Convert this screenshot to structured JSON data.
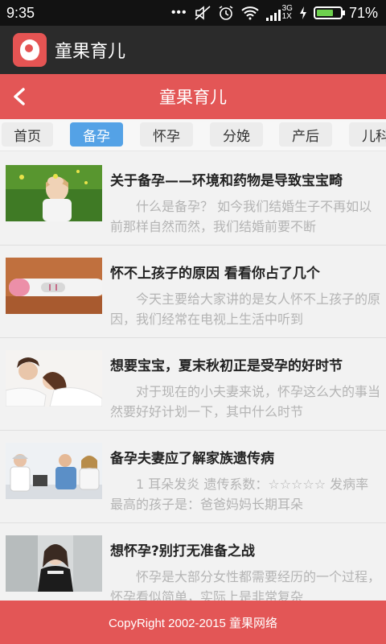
{
  "status_bar": {
    "time": "9:35",
    "network": "3G",
    "network_sub": "1X",
    "battery": "71%",
    "battery_level": 0.71,
    "icons": [
      "more-icon",
      "mute-icon",
      "alarm-icon",
      "wifi-icon",
      "signal-icon",
      "charging-icon",
      "battery-icon"
    ]
  },
  "app_header": {
    "title": "童果育儿",
    "logo_icon": "baby-logo-icon"
  },
  "title_bar": {
    "title": "童果育儿",
    "back_icon": "chevron-left-icon"
  },
  "tabs": [
    {
      "label": "首页",
      "active": false
    },
    {
      "label": "备孕",
      "active": true
    },
    {
      "label": "怀孕",
      "active": false
    },
    {
      "label": "分娩",
      "active": false
    },
    {
      "label": "产后",
      "active": false
    },
    {
      "label": "儿科",
      "active": false
    }
  ],
  "articles": [
    {
      "title": "关于备孕——环境和药物是导致宝宝畸",
      "desc": "什么是备孕？ 如今我们结婚生子不再如以前那样自然而然，我们结婚前要不断",
      "image": "child-on-grass-image"
    },
    {
      "title": "怀不上孩子的原因 看看你占了几个",
      "desc": "今天主要给大家讲的是女人怀不上孩子的原因，我们经常在电视上生活中听到",
      "image": "pregnancy-test-image"
    },
    {
      "title": "想要宝宝，夏末秋初正是受孕的好时节",
      "desc": "对于现在的小夫妻来说，怀孕这么大的事当然要好好计划一下，其中什么时节",
      "image": "couple-lying-image"
    },
    {
      "title": "备孕夫妻应了解家族遗传病",
      "desc": "1 耳朵发炎 遗传系数：☆☆☆☆☆ 发病率最高的孩子是：爸爸妈妈长期耳朵",
      "image": "doctor-consultation-image"
    },
    {
      "title": "想怀孕?别打无准备之战",
      "desc": "怀孕是大部分女性都需要经历的一个过程，怀孕看似简单，实际上是非常复杂",
      "image": "pregnant-woman-image"
    }
  ],
  "footer": {
    "text": "CopyRight 2002-2015 童果网络"
  },
  "colors": {
    "brand_red": "#e35656",
    "active_tab": "#54a2e6",
    "app_bar": "#2b2b2b",
    "status_bar": "#121212"
  }
}
